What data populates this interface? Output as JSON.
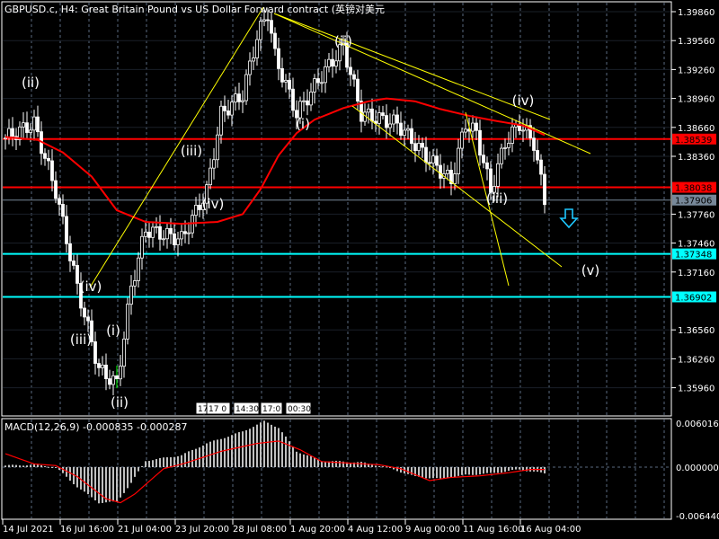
{
  "header": {
    "title": "GBPUSD.c, H4:  Great Britain Pound vs US Dollar Forward contract (英镑对美元"
  },
  "macd_label": "MACD(12,26,9) -0.000835 -0.000287",
  "time_boxes": [
    "17:",
    "17 0",
    "14:30",
    "17:0",
    "00:30"
  ],
  "colors": {
    "bg": "#000000",
    "grid": "#5a6a80",
    "candle": "#ffffff",
    "ma": "#ff0000",
    "trend": "#ffff00",
    "cyan": "#00ffff",
    "axis": "#ffffff"
  },
  "chart_data": [
    {
      "type": "candlestick",
      "title": "GBPUSD.c, H4",
      "ylim": [
        1.358,
        1.3995
      ],
      "y_ticks": [
        "1.39860",
        "1.39560",
        "1.39260",
        "1.38960",
        "1.38660",
        "1.38360",
        "1.37760",
        "1.37460",
        "1.37160",
        "1.36560",
        "1.36260",
        "1.35960"
      ],
      "x_ticks": [
        "14 Jul 2021",
        "16 Jul 16:00",
        "21 Jul 04:00",
        "23 Jul 20:00",
        "28 Jul 08:00",
        "1 Aug 20:00",
        "4 Aug 12:00",
        "9 Aug 00:00",
        "11 Aug 16:00",
        "16 Aug 04:00"
      ],
      "price_path": [
        [
          0,
          1.3855
        ],
        [
          8,
          1.387
        ],
        [
          14,
          1.38
        ],
        [
          20,
          1.37
        ],
        [
          26,
          1.3615
        ],
        [
          31,
          1.36
        ],
        [
          35,
          1.37
        ],
        [
          39,
          1.376
        ],
        [
          49,
          1.375
        ],
        [
          56,
          1.38
        ],
        [
          60,
          1.388
        ],
        [
          66,
          1.39
        ],
        [
          70,
          1.396
        ],
        [
          73,
          1.3985
        ],
        [
          75,
          1.394
        ],
        [
          81,
          1.388
        ],
        [
          88,
          1.392
        ],
        [
          94,
          1.395
        ],
        [
          99,
          1.388
        ],
        [
          109,
          1.387
        ],
        [
          116,
          1.384
        ],
        [
          124,
          1.381
        ],
        [
          128,
          1.387
        ],
        [
          131,
          1.386
        ],
        [
          135,
          1.38
        ],
        [
          139,
          1.385
        ],
        [
          143,
          1.387
        ],
        [
          147,
          1.385
        ],
        [
          150,
          1.379
        ]
      ],
      "ma_path": [
        [
          0,
          1.3856
        ],
        [
          9,
          1.3853
        ],
        [
          16,
          1.384
        ],
        [
          24,
          1.3815
        ],
        [
          31,
          1.378
        ],
        [
          39,
          1.3768
        ],
        [
          49,
          1.3766
        ],
        [
          59,
          1.3768
        ],
        [
          66,
          1.3776
        ],
        [
          71,
          1.3802
        ],
        [
          76,
          1.3837
        ],
        [
          81,
          1.386
        ],
        [
          86,
          1.3874
        ],
        [
          94,
          1.3886
        ],
        [
          101,
          1.3893
        ],
        [
          106,
          1.3896
        ],
        [
          114,
          1.3893
        ],
        [
          121,
          1.3885
        ],
        [
          129,
          1.3878
        ],
        [
          136,
          1.3873
        ],
        [
          144,
          1.3868
        ],
        [
          150,
          1.3858
        ]
      ],
      "levels": [
        {
          "value": "1.38539",
          "color": "#ff0000",
          "label_bg": "#ff0000",
          "label_fg": "#000000"
        },
        {
          "value": "1.38038",
          "color": "#ff0000",
          "label_bg": "#ff0000",
          "label_fg": "#000000"
        },
        {
          "value": "1.37348",
          "color": "#00ffff",
          "label_bg": "#00ffff",
          "label_fg": "#000000"
        },
        {
          "value": "1.36902",
          "color": "#00ffff",
          "label_bg": "#00ffff",
          "label_fg": "#000000"
        }
      ],
      "current_price": "1.37906",
      "wave_labels": [
        "(ii)",
        "(iii)",
        "(iv)",
        "(iv)",
        "(iii)",
        "(i)",
        "(ii)",
        "(i)",
        "(ii)",
        "(iv)",
        "(iii)",
        "(v)"
      ]
    },
    {
      "type": "bar+line",
      "title": "MACD(12,26,9)",
      "ylim": [
        -0.00644,
        0.006016
      ],
      "y_ticks": [
        "0.006016",
        "0.000000",
        "-0.006440"
      ],
      "hist_path": [
        [
          0,
          0.0002
        ],
        [
          8,
          0.0003
        ],
        [
          14,
          0.0
        ],
        [
          20,
          -0.0025
        ],
        [
          26,
          -0.0045
        ],
        [
          31,
          -0.0044
        ],
        [
          35,
          -0.002
        ],
        [
          39,
          0.0008
        ],
        [
          49,
          0.0015
        ],
        [
          56,
          0.003
        ],
        [
          66,
          0.0045
        ],
        [
          72,
          0.0058
        ],
        [
          76,
          0.005
        ],
        [
          81,
          0.002
        ],
        [
          88,
          0.0008
        ],
        [
          99,
          0.0006
        ],
        [
          106,
          0.0
        ],
        [
          114,
          -0.0012
        ],
        [
          121,
          -0.0015
        ],
        [
          128,
          -0.001
        ],
        [
          135,
          -0.0008
        ],
        [
          143,
          -0.0003
        ],
        [
          150,
          -0.0008
        ]
      ],
      "signal_path": [
        [
          0,
          0.0017
        ],
        [
          8,
          0.0004
        ],
        [
          14,
          0.0002
        ],
        [
          20,
          -0.0012
        ],
        [
          28,
          -0.004
        ],
        [
          32,
          -0.0045
        ],
        [
          36,
          -0.0034
        ],
        [
          44,
          -0.0002
        ],
        [
          50,
          0.0005
        ],
        [
          60,
          0.002
        ],
        [
          70,
          0.003
        ],
        [
          76,
          0.0033
        ],
        [
          82,
          0.0022
        ],
        [
          88,
          0.0007
        ],
        [
          96,
          0.0005
        ],
        [
          104,
          0.0003
        ],
        [
          110,
          -0.0002
        ],
        [
          118,
          -0.0017
        ],
        [
          124,
          -0.0013
        ],
        [
          132,
          -0.0011
        ],
        [
          140,
          -0.0007
        ],
        [
          146,
          -0.0003
        ],
        [
          150,
          -0.0003
        ]
      ]
    }
  ]
}
